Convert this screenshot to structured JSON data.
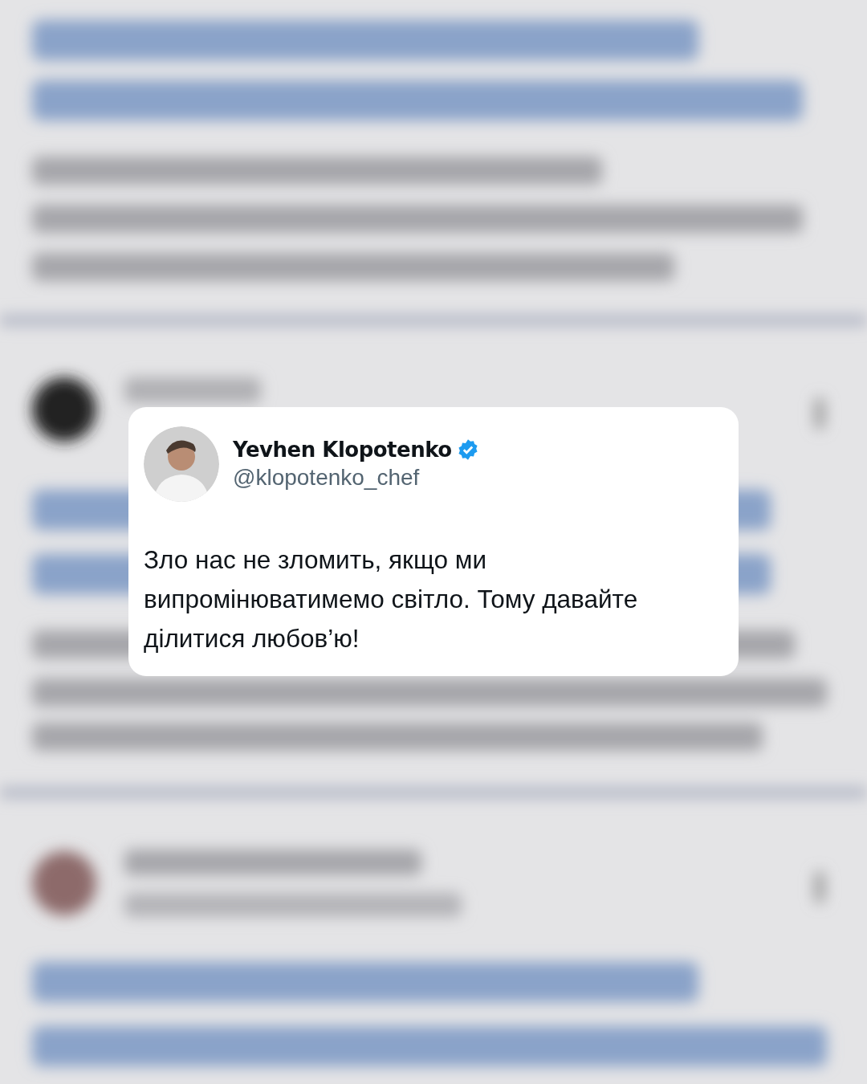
{
  "tweet": {
    "name": "Yevhen Klopotenko",
    "verified": true,
    "handle": "@klopotenko_chef",
    "text": "Зло нас не зломить, якщо ми випромінюватимемо світло. Тому давайте ділитися любов’ю!"
  }
}
